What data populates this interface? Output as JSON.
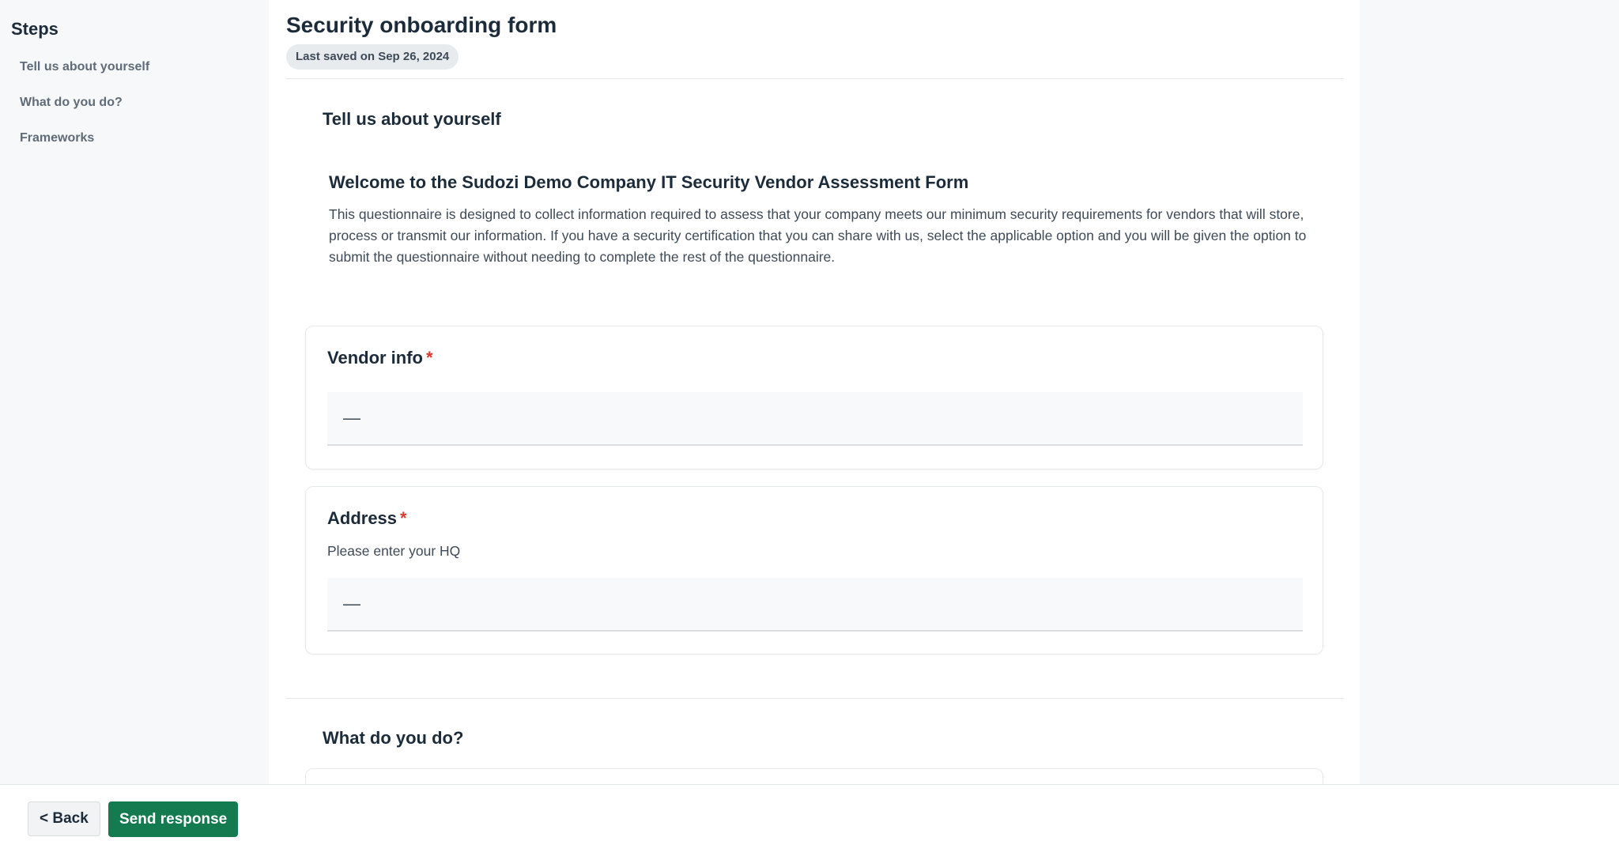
{
  "sidebar": {
    "title": "Steps",
    "items": [
      {
        "label": "Tell us about yourself"
      },
      {
        "label": "What do you do?"
      },
      {
        "label": "Frameworks"
      }
    ]
  },
  "form": {
    "title": "Security onboarding form",
    "last_saved": "Last saved on Sep 26, 2024"
  },
  "sections": [
    {
      "title": "Tell us about yourself",
      "welcome_heading": "Welcome to the Sudozi Demo Company IT Security Vendor Assessment Form",
      "welcome_body": "This questionnaire is designed to collect information required to assess that your company meets our minimum security requirements for vendors that will store, process or transmit our information. If you have a security certification that you can share with us, select the applicable option and you will be given the option to submit the questionnaire without needing to complete the rest of the questionnaire.",
      "questions": [
        {
          "label": "Vendor info",
          "required_mark": "*",
          "value": "—"
        },
        {
          "label": "Address",
          "required_mark": "*",
          "help": "Please enter your HQ",
          "value": "—"
        }
      ]
    },
    {
      "title": "What do you do?"
    }
  ],
  "footer": {
    "back_label": "< Back",
    "send_label": "Send response"
  },
  "colors": {
    "primary": "#147a50",
    "required": "#d93a2b",
    "text": "#1c2b3a",
    "muted": "#5f6b78"
  }
}
